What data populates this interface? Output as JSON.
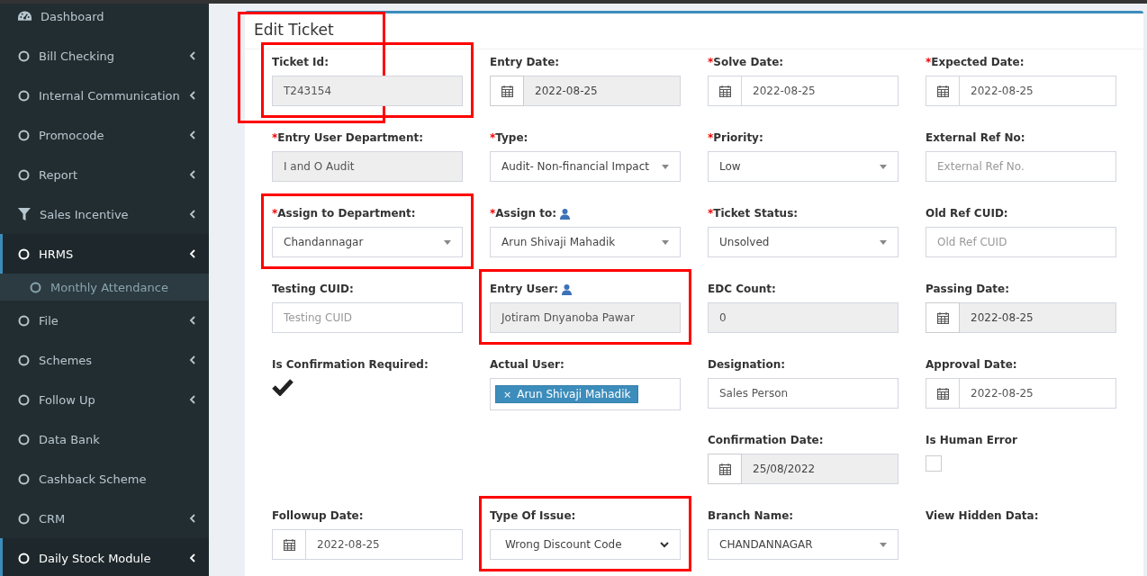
{
  "sidebar": {
    "items": [
      {
        "label": "Dashboard",
        "kind": "dashboard",
        "submenu": false,
        "active": false
      },
      {
        "label": "Bill Checking",
        "kind": "circle",
        "submenu": true,
        "active": false
      },
      {
        "label": "Internal Communication",
        "kind": "circle",
        "submenu": true,
        "active": false
      },
      {
        "label": "Promocode",
        "kind": "circle",
        "submenu": true,
        "active": false
      },
      {
        "label": "Report",
        "kind": "circle",
        "submenu": true,
        "active": false
      },
      {
        "label": "Sales Incentive",
        "kind": "filter",
        "submenu": true,
        "active": false
      },
      {
        "label": "HRMS",
        "kind": "circle",
        "submenu": true,
        "active": true,
        "expanded": true,
        "children": [
          {
            "label": "Monthly Attendance"
          }
        ]
      },
      {
        "label": "File",
        "kind": "circle",
        "submenu": true,
        "active": false
      },
      {
        "label": "Schemes",
        "kind": "circle",
        "submenu": true,
        "active": false
      },
      {
        "label": "Follow Up",
        "kind": "circle",
        "submenu": true,
        "active": false
      },
      {
        "label": "Data Bank",
        "kind": "circle",
        "submenu": false,
        "active": false
      },
      {
        "label": "Cashback Scheme",
        "kind": "circle",
        "submenu": false,
        "active": false
      },
      {
        "label": "CRM",
        "kind": "circle",
        "submenu": true,
        "active": false
      },
      {
        "label": "Daily Stock Module",
        "kind": "circle",
        "submenu": true,
        "active": true
      }
    ]
  },
  "card": {
    "title": "Edit Ticket",
    "title_highlighted": true,
    "rows": [
      [
        {
          "label": "Ticket Id:",
          "kind": "readonly",
          "value": "T243154",
          "highlighted": true
        },
        {
          "label": "Entry Date:",
          "kind": "date",
          "readonly": true,
          "value": "2022-08-25"
        },
        {
          "required": "*",
          "label": "Solve Date:",
          "kind": "date",
          "readonly": false,
          "value": "2022-08-25"
        },
        {
          "required": "*",
          "label": "Expected Date:",
          "kind": "date",
          "readonly": false,
          "value": "2022-08-25"
        }
      ],
      [
        {
          "required": "*",
          "label": "Entry User Department:",
          "kind": "readonly",
          "value": "I and O Audit"
        },
        {
          "required": "*",
          "label": "Type:",
          "kind": "select",
          "value": "Audit- Non-financial Impact"
        },
        {
          "required": "*",
          "label": "Priority:",
          "kind": "select",
          "value": "Low"
        },
        {
          "label": "External Ref No:",
          "kind": "input",
          "placeholder": "External Ref No."
        }
      ],
      [
        {
          "required": "*",
          "label": "Assign to Department:",
          "kind": "select",
          "value": "Chandannagar",
          "highlighted": true
        },
        {
          "required": "*",
          "label": "Assign to:",
          "user_icon": true,
          "kind": "select",
          "value": "Arun Shivaji Mahadik"
        },
        {
          "required": "*",
          "label": "Ticket Status:",
          "kind": "select",
          "value": "Unsolved"
        },
        {
          "label": "Old Ref CUID:",
          "kind": "input",
          "placeholder": "Old Ref CUID"
        }
      ],
      [
        {
          "label": "Testing CUID:",
          "kind": "input",
          "placeholder": "Testing CUID"
        },
        {
          "label": "Entry User:",
          "user_icon": true,
          "kind": "readonly",
          "value": "Jotiram Dnyanoba Pawar",
          "highlighted": true
        },
        {
          "label": "EDC Count:",
          "kind": "readonly",
          "value": "0"
        },
        {
          "label": "Passing Date:",
          "kind": "date",
          "readonly": true,
          "value": "2022-08-25"
        }
      ],
      [
        {
          "label": "Is Confirmation Required:",
          "kind": "tick",
          "checked": true
        },
        {
          "label": "Actual User:",
          "kind": "tags",
          "tags": [
            {
              "remove": "×",
              "label": "Arun Shivaji Mahadik"
            }
          ]
        },
        {
          "label": "Designation:",
          "kind": "input",
          "value": "Sales Person"
        },
        {
          "label": "Approval Date:",
          "kind": "date",
          "readonly": false,
          "value": "2022-08-25"
        }
      ],
      [
        "",
        "",
        {
          "label": "Confirmation Date:",
          "kind": "date",
          "readonly": true,
          "value": "25/08/2022"
        },
        {
          "label": "Is Human Error",
          "kind": "checkbox",
          "checked": false
        }
      ],
      [
        {
          "label": "Followup Date:",
          "kind": "date",
          "readonly": false,
          "value": "2022-08-25"
        },
        {
          "label": "Type Of Issue:",
          "kind": "native-select",
          "value": "Wrong Discount Code",
          "highlighted": true
        },
        {
          "label": "Branch Name:",
          "kind": "select",
          "value": "CHANDANNAGAR"
        },
        {
          "label": "View Hidden Data:",
          "kind": "none"
        }
      ]
    ]
  }
}
